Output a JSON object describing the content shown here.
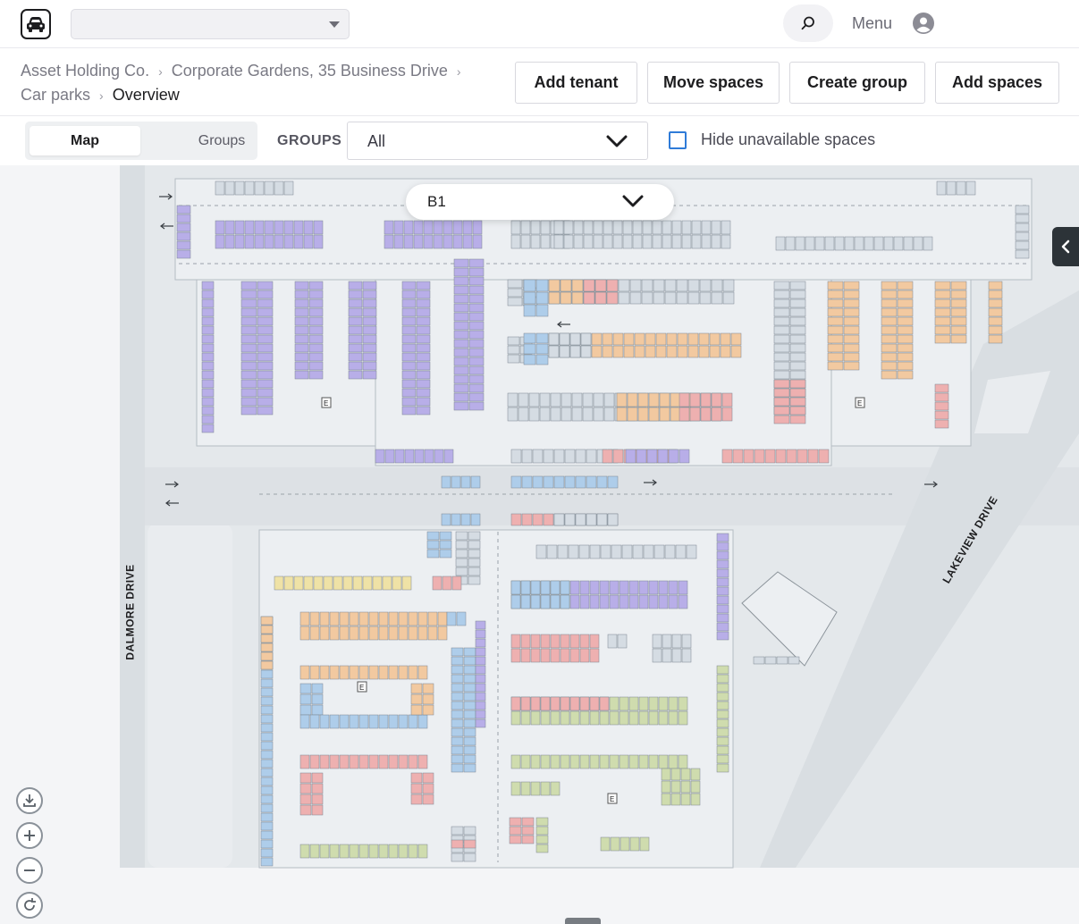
{
  "header": {
    "logo_icon": "car-icon",
    "site_select_value": "",
    "search_icon": "search-icon",
    "menu_label": "Menu",
    "user_icon": "user-avatar-icon"
  },
  "breadcrumb": {
    "items": [
      "Asset Holding Co.",
      "Corporate Gardens, 35 Business Drive",
      "Car parks"
    ],
    "current": "Overview"
  },
  "actions": {
    "add_tenant": "Add tenant",
    "move_spaces": "Move spaces",
    "create_group": "Create group",
    "add_spaces": "Add spaces"
  },
  "filters": {
    "view_tabs": [
      "Map",
      "Groups"
    ],
    "active_view": "Map",
    "groups_label": "GROUPS",
    "groups_value": "All",
    "hide_unavailable_label": "Hide unavailable spaces",
    "hide_unavailable_checked": false
  },
  "map": {
    "level_value": "B1",
    "streets": {
      "west": "DALMORE DRIVE",
      "east": "LAKEVIEW DRIVE"
    },
    "entry_marker": "E",
    "controls": {
      "download_icon": "download-icon",
      "zoom_in_icon": "plus-icon",
      "zoom_out_icon": "minus-icon",
      "reset_icon": "refresh-icon"
    },
    "colors": {
      "purple": "#b8aee8",
      "blue": "#aecdea",
      "lightblue": "#c3d8ef",
      "orange": "#f2c9a0",
      "pink": "#eeb0b0",
      "green": "#cfdcae",
      "yellow": "#efe2a6",
      "grey": "#d5dce3",
      "road": "#dde1e5",
      "structure": "#e8ebee"
    }
  }
}
